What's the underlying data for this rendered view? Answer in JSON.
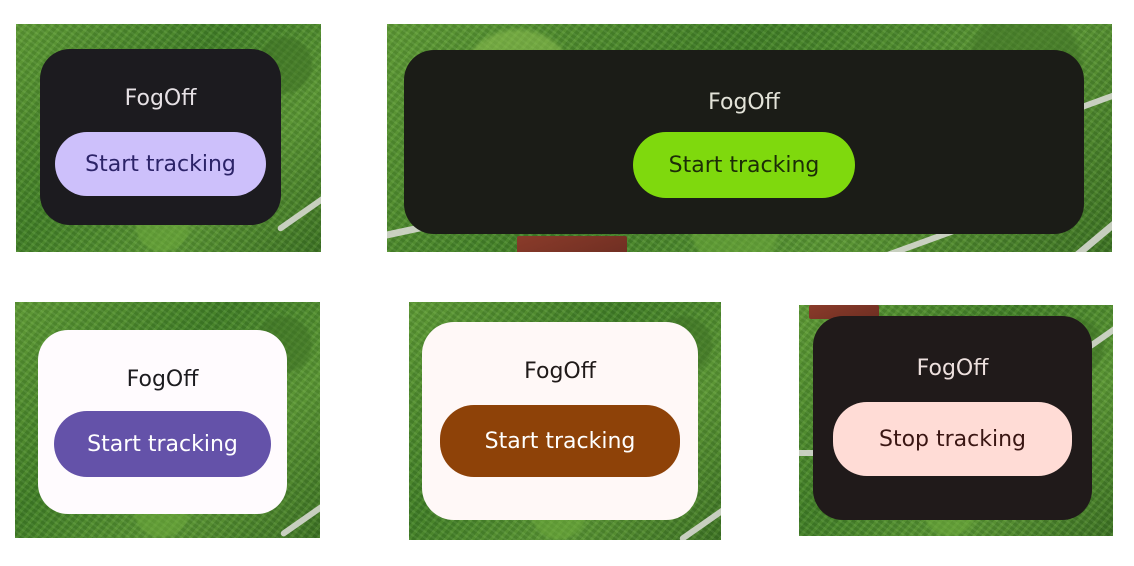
{
  "widgets": [
    {
      "title": "FogOff",
      "button_label": "Start tracking",
      "theme": "dark",
      "card_color": "#1c1b1f",
      "button_color": "#cdc0fb"
    },
    {
      "title": "FogOff",
      "button_label": "Start tracking",
      "theme": "dark",
      "card_color": "#1b1c17",
      "button_color": "#7fd90d"
    },
    {
      "title": "FogOff",
      "button_label": "Start tracking",
      "theme": "light",
      "card_color": "#fffbfe",
      "button_color": "#6452a9"
    },
    {
      "title": "FogOff",
      "button_label": "Start tracking",
      "theme": "light",
      "card_color": "#fff8f7",
      "button_color": "#8e4208"
    },
    {
      "title": "FogOff",
      "button_label": "Stop tracking",
      "theme": "dark",
      "card_color": "#201a1a",
      "button_color": "#ffdcd6"
    }
  ],
  "background": {
    "description_icon": "map-satellite-background"
  }
}
